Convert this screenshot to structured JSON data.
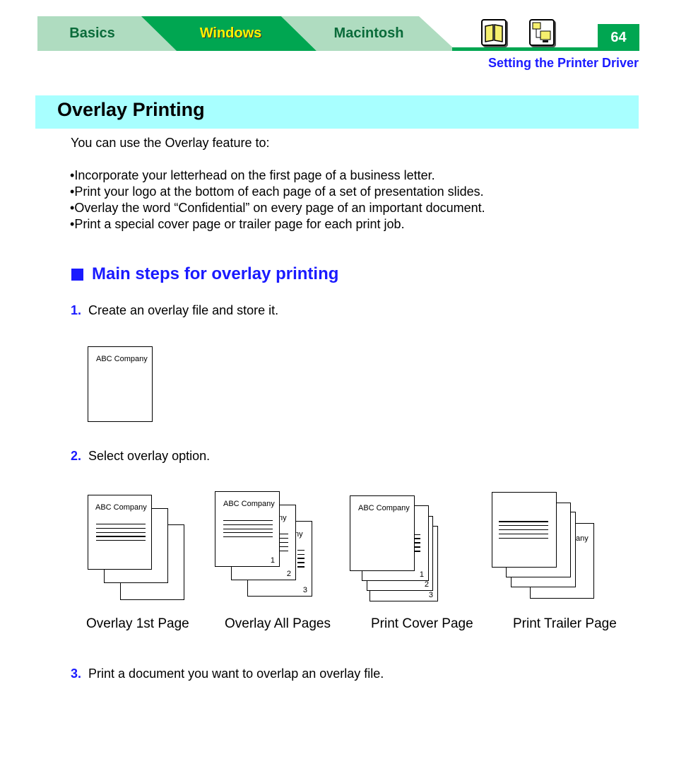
{
  "header": {
    "tabs": [
      {
        "label": "Basics",
        "active": false
      },
      {
        "label": "Windows",
        "active": true
      },
      {
        "label": "Macintosh",
        "active": false
      }
    ],
    "icons": [
      "book-icon",
      "network-computer-icon"
    ],
    "page_number": "64",
    "section": "Setting the Printer Driver",
    "colors": {
      "tab_light": "#afdcc0",
      "tab_dark": "#00a651",
      "active_text": "#fff200",
      "link_blue": "#1a1aff",
      "title_band": "#a8ffff"
    }
  },
  "title": "Overlay Printing",
  "intro": "You can use the Overlay feature to:",
  "bullets": [
    "Incorporate your letterhead on the first page of a business letter.",
    "Print your logo at the bottom of each page of a set of presentation slides.",
    "Overlay the word “Confidential” on every page of an important document.",
    "Print a special cover page or trailer page for each print job."
  ],
  "subheading": "Main steps for overlay printing",
  "steps": [
    {
      "num": "1.",
      "text": "Create an overlay file and store it."
    },
    {
      "num": "2.",
      "text": "Select overlay option."
    },
    {
      "num": "3.",
      "text": "Print a document you want to overlap an overlay file."
    }
  ],
  "figure": {
    "company": "ABC Company",
    "fragment_ny": "ny",
    "fragment_any": "any",
    "page_numbers": [
      "1",
      "2",
      "3"
    ],
    "captions": [
      "Overlay 1st Page",
      "Overlay All Pages",
      "Print Cover Page",
      "Print Trailer Page"
    ]
  }
}
